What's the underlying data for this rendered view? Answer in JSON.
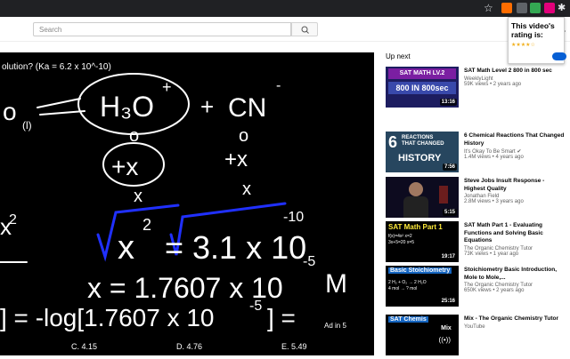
{
  "search": {
    "placeholder": "Search"
  },
  "popup": {
    "title": "This video's rating is:",
    "stars": "★★★★☆"
  },
  "video": {
    "question": "olution?  (Ka = 6.2 x 10^-10)",
    "answers": [
      "C. 4.15",
      "D. 4.76",
      "E. 5.49"
    ],
    "ad_label": "Ad in 5"
  },
  "upnext": {
    "label": "Up next",
    "items": [
      {
        "title": "SAT Math Level 2 800 in 800 sec",
        "channel": "WeeklyLight",
        "views": "59K views • 2 years ago",
        "duration": "13:16",
        "thumb_text": "SAT MATH LV.2 / 800 IN 800sec",
        "thumb_color": "#1d1d60"
      },
      {
        "title": "6 Chemical Reactions That Changed History",
        "channel": "It's Okay To Be Smart ✔",
        "views": "1.4M views • 4 years ago",
        "duration": "7:56",
        "thumb_text": "6 REACTIONS THAT CHANGED HISTORY",
        "thumb_color": "#27465f"
      },
      {
        "title": "Steve Jobs Insult Response - Highest Quality",
        "channel": "Jonathan Field",
        "views": "2.8M views • 3 years ago",
        "duration": "5:15",
        "thumb_text": "",
        "thumb_color": "#0d0b1f"
      },
      {
        "title": "SAT Math Part 1 - Evaluating Functions and Solving Basic Equations",
        "channel": "The Organic Chemistry Tutor",
        "views": "73K views • 1 year ago",
        "duration": "19:17",
        "thumb_text": "SAT Math Part 1",
        "thumb_color": "#000000"
      },
      {
        "title": "Stoichiometry Basic Introduction, Mole to Mole,...",
        "channel": "The Organic Chemistry Tutor",
        "views": "650K views • 2 years ago",
        "duration": "25:16",
        "thumb_text": "Basic Stoichiometry",
        "thumb_color": "#000000"
      },
      {
        "title": "Mix - The Organic Chemistry Tutor",
        "channel": "YouTube",
        "views": "",
        "duration": "",
        "thumb_text": "SAT Chemis",
        "thumb_color": "#000000",
        "mix_label": "Mix"
      }
    ]
  },
  "colors": {
    "accent": "#065fd4",
    "chrome": "#202124"
  }
}
